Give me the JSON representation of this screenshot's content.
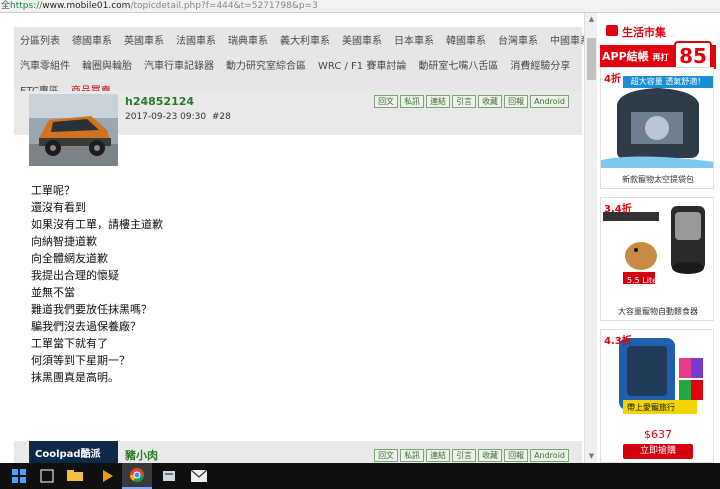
{
  "browser": {
    "left_glyph": "全",
    "url_scheme": "https://",
    "url_host": "www.mobile01.com",
    "url_path": "/topicdetail.php?f=444&t=5271798&p=3"
  },
  "nav": {
    "row1": [
      "分區列表",
      "德國車系",
      "英國車系",
      "法國車系",
      "瑞典車系",
      "義大利車系",
      "美國車系",
      "日本車系",
      "韓國車系",
      "台灣車系",
      "中國車系"
    ],
    "row2": [
      "汽車零組件",
      "輪圈與輪胎",
      "汽車行車記錄器",
      "動力研究室綜合區",
      "WRC / F1 賽車討論",
      "動研室七嘴八舌區",
      "消費經驗分享"
    ],
    "row3": [
      "ETC專區",
      "商品買賣"
    ]
  },
  "post1": {
    "username": "h24852124",
    "time": "2017-09-23 09:30",
    "floor": "#28",
    "actions": [
      "回文",
      "私訊",
      "連結",
      "引言",
      "收藏",
      "回報",
      "Android"
    ],
    "lines": [
      "工單呢？",
      "還沒有看到",
      "如果沒有工單，請樓主道歉",
      "向納智捷道歉",
      "向全體網友道歉",
      "我提出合理的懷疑",
      "並無不當",
      "難道我們要放任抹黑嗎？",
      "騙我們沒去過保養廠？",
      "工單當下就有了",
      "何須等到下星期一？",
      "抹黑團真是高明。"
    ]
  },
  "post2": {
    "username": "豬小肉",
    "actions": [
      "回文",
      "私訊",
      "連結",
      "引言",
      "收藏",
      "回報",
      "Android"
    ],
    "avatar_text": "Coolpad酷派"
  },
  "ads": {
    "banner_brand": "生活市集",
    "banner_app": "APP結帳",
    "banner_extra": "再打",
    "banner_big": "85",
    "banner_unit": "折",
    "items": [
      {
        "discount": "4折",
        "caption": "新款寵物太空提袋包",
        "overlay": "超大容量 透氣舒適！"
      },
      {
        "discount": "3.4折",
        "caption": "大容量寵物自動餵食器",
        "overlay": "5.5 Liter"
      },
      {
        "discount": "4.3折",
        "caption": "",
        "overlay": "帶上愛寵旅行",
        "price": "$637",
        "button": "立即搶購"
      }
    ]
  },
  "colors": {
    "accent_red": "#e2000f",
    "username_green": "#2a7a2a",
    "nav_bg": "#e6e6e6",
    "taskbar": "#101010"
  },
  "taskbar_icons": [
    "windows-start-icon",
    "search-icon",
    "task-view-icon",
    "file-explorer-icon",
    "store-icon",
    "media-player-icon",
    "chrome-icon",
    "files-icon",
    "photos-icon",
    "mail-icon"
  ]
}
